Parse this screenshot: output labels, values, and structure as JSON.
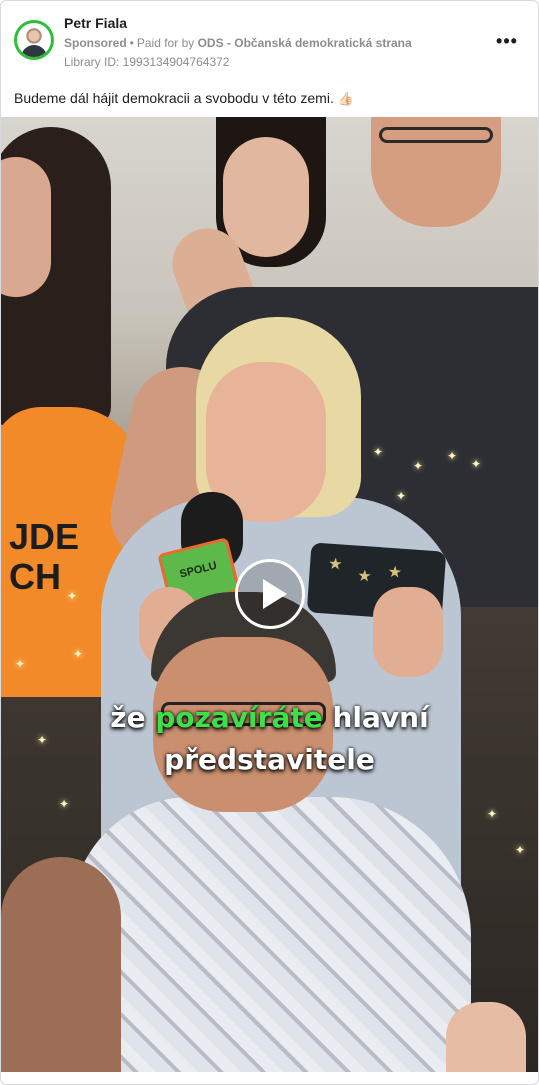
{
  "post": {
    "author": "Petr Fiala",
    "sponsored_label": "Sponsored",
    "paid_for_prefix": "Paid for by",
    "payer": "ODS - Občanská demokratická strana",
    "library_id": "Library ID: 1993134904764372",
    "caption": "Budeme dál hájit demokracii a svobodu v této zemi.",
    "caption_emoji": "👍🏻",
    "menu_icon": "more-horizontal-icon"
  },
  "video": {
    "subtitle_word1": "že",
    "subtitle_highlight": "pozavíráte",
    "subtitle_word2": "hlavní",
    "subtitle_line2": "představitele",
    "mic_label": "SPOLU",
    "shirt_text": "JDE\nCH",
    "highlight_color": "#3ee04a",
    "play_icon": "play-icon"
  },
  "colors": {
    "avatar_ring": "#2bbf3a",
    "text_primary": "#1c1e21",
    "text_secondary": "#8a8d91"
  }
}
